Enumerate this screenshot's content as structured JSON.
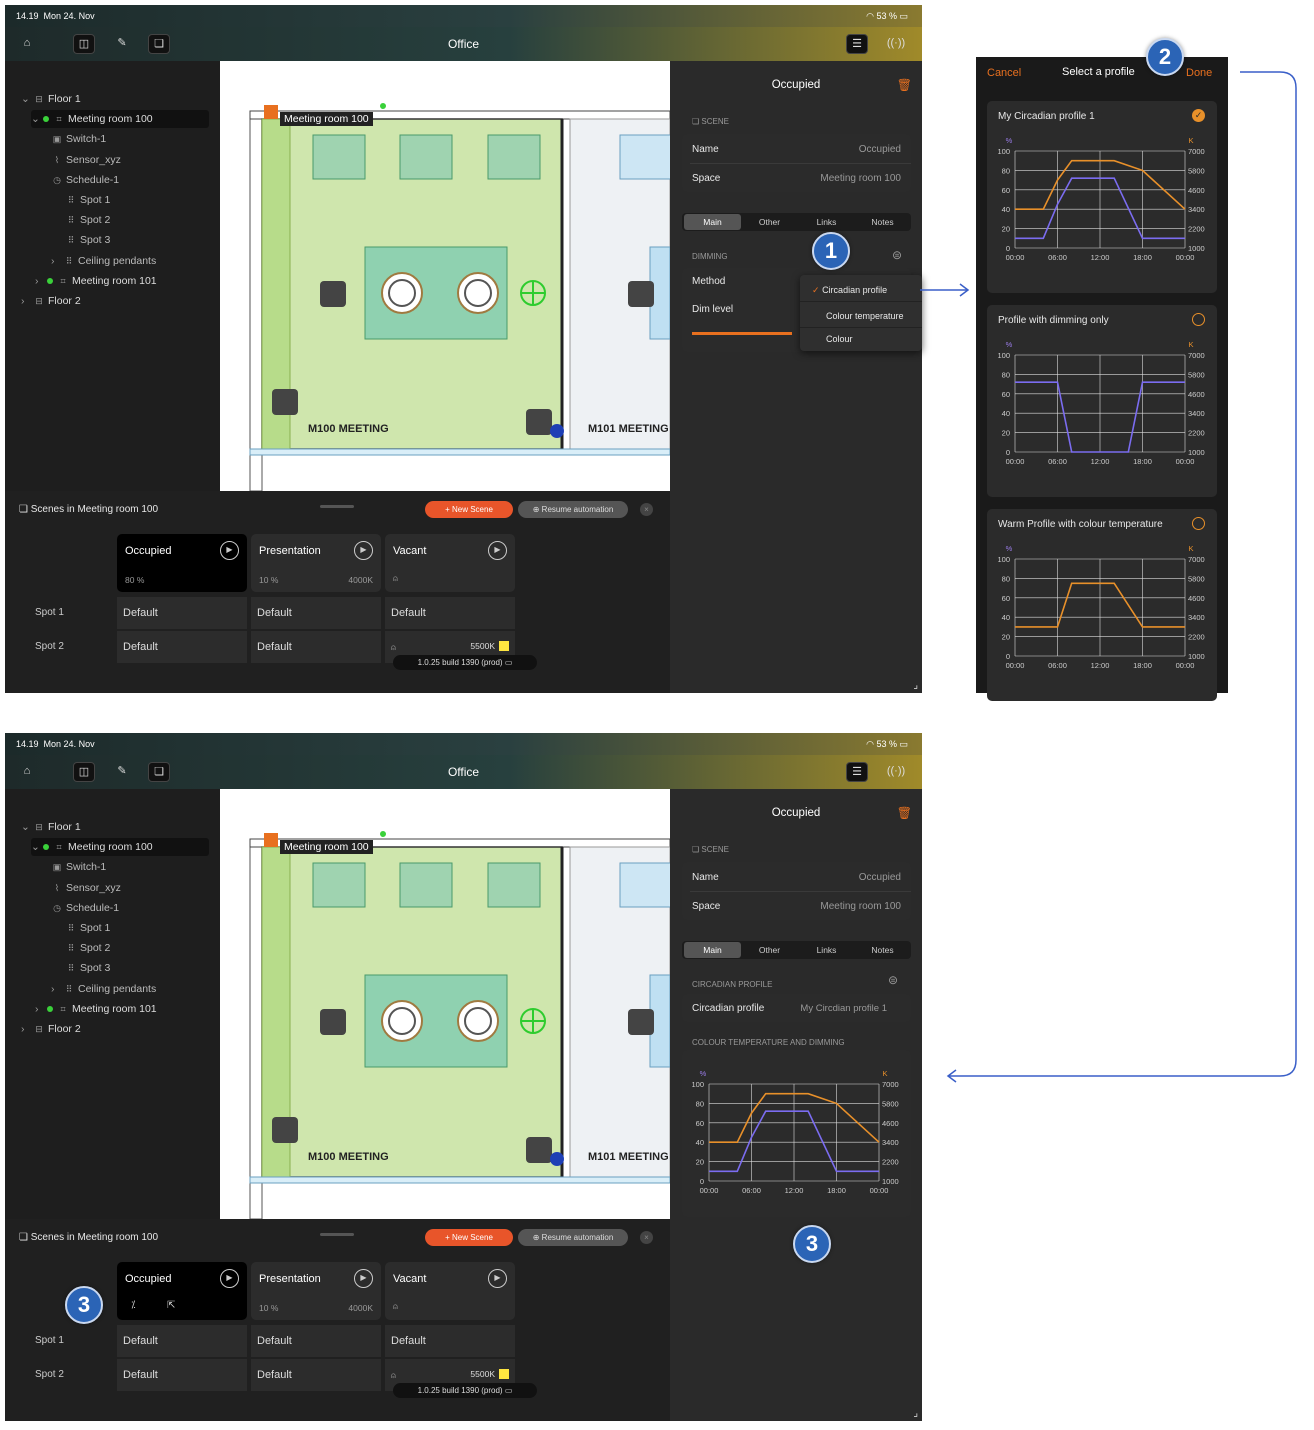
{
  "status_bar": {
    "time": "14.19",
    "date": "Mon 24. Nov",
    "battery": "53 %"
  },
  "toolbar": {
    "title": "Office"
  },
  "tree": [
    {
      "label": "Floor 1",
      "level": 0,
      "chevron": "down",
      "icon": "floor-icon"
    },
    {
      "label": "Meeting room 100",
      "level": 1,
      "chevron": "down",
      "icon": "room-icon",
      "online": true,
      "selected": true
    },
    {
      "label": "Switch-1",
      "level": 2,
      "icon": "switch-icon"
    },
    {
      "label": "Sensor_xyz",
      "level": 2,
      "icon": "sensor-icon"
    },
    {
      "label": "Schedule-1",
      "level": 2,
      "icon": "schedule-icon"
    },
    {
      "label": "Spot 1",
      "level": 3,
      "icon": "light-group-icon"
    },
    {
      "label": "Spot 2",
      "level": 3,
      "icon": "light-group-icon"
    },
    {
      "label": "Spot 3",
      "level": 3,
      "icon": "light-group-icon"
    },
    {
      "label": "Ceiling pendants",
      "level": 2,
      "chevron": "right",
      "icon": "light-group-icon"
    },
    {
      "label": "Meeting room 101",
      "level": 1,
      "chevron": "right",
      "icon": "room-icon",
      "online": true
    },
    {
      "label": "Floor 2",
      "level": 0,
      "chevron": "right",
      "icon": "floor-icon"
    }
  ],
  "floorplan": {
    "room_tag": "Meeting room 100",
    "room1_label": "M100 MEETING",
    "room2_label": "M101 MEETING"
  },
  "scenes_panel": {
    "title": "Scenes in Meeting room 100",
    "new_scene": "New Scene",
    "resume": "Resume automation",
    "scenes_top": [
      {
        "name": "Occupied",
        "left": "80 %",
        "right": "",
        "active": true
      },
      {
        "name": "Presentation",
        "left": "10 %",
        "right": "4000K",
        "active": false
      },
      {
        "name": "Vacant",
        "left": "",
        "right": "",
        "active": false
      }
    ],
    "scenes_bottom": [
      {
        "name": "Occupied",
        "left": "",
        "right": "",
        "active": true
      },
      {
        "name": "Presentation",
        "left": "10 %",
        "right": "4000K",
        "active": false
      },
      {
        "name": "Vacant",
        "left": "",
        "right": "",
        "active": false
      }
    ],
    "rows": [
      {
        "label": "Spot 1",
        "cells": [
          "Default",
          "Default",
          "Default"
        ]
      },
      {
        "label": "Spot 2",
        "cells": [
          "Default",
          "Default",
          "5500K"
        ]
      }
    ],
    "build": "1.0.25 build 1390 (prod)"
  },
  "detail": {
    "title": "Occupied",
    "scene_header": "SCENE",
    "name_label": "Name",
    "name_value": "Occupied",
    "space_label": "Space",
    "space_value": "Meeting room 100",
    "tabs": [
      "Main",
      "Other",
      "Links",
      "Notes"
    ],
    "dimming_header": "DIMMING",
    "method_label": "Method",
    "dim_label": "Dim level",
    "dropdown": [
      "Circadian profile",
      "Colour temperature",
      "Colour"
    ],
    "circ_header": "CIRCADIAN PROFILE",
    "circ_label": "Circadian profile",
    "circ_value": "My Circdian profile 1",
    "ct_header": "COLOUR TEMPERATURE AND DIMMING"
  },
  "profile_picker": {
    "cancel": "Cancel",
    "title": "Select a profile",
    "done": "Done",
    "profiles": [
      {
        "name": "My Circadian profile 1",
        "selected": true
      },
      {
        "name": "Profile with dimming only",
        "selected": false
      },
      {
        "name": "Warm Profile with colour temperature",
        "selected": false
      }
    ]
  },
  "chart_axes": {
    "left_unit": "%",
    "right_unit": "K",
    "left_ticks": [
      "100",
      "80",
      "60",
      "40",
      "20",
      "0"
    ],
    "right_ticks": [
      "7000",
      "5800",
      "4600",
      "3400",
      "2200",
      "1000"
    ],
    "x_ticks": [
      "00:00",
      "06:00",
      "12:00",
      "18:00",
      "00:00"
    ]
  },
  "chart_data": [
    {
      "type": "line",
      "title": "My Circadian profile 1",
      "x": [
        "00:00",
        "04:00",
        "06:00",
        "08:00",
        "12:00",
        "14:00",
        "18:00",
        "24:00"
      ],
      "ylim": [
        0,
        100
      ],
      "y2lim": [
        1000,
        7000
      ],
      "series": [
        {
          "axis": "y2",
          "color": "#e8902a",
          "values_x_hours": [
            0,
            4,
            6,
            8,
            12,
            14,
            18,
            24
          ],
          "values": [
            3400,
            3400,
            5200,
            6400,
            6400,
            6400,
            5800,
            3400
          ]
        },
        {
          "axis": "y",
          "color": "#7b6cf0",
          "values_x_hours": [
            0,
            4,
            6,
            8,
            12,
            14,
            18,
            24
          ],
          "values": [
            10,
            10,
            45,
            72,
            72,
            72,
            10,
            10
          ]
        }
      ]
    },
    {
      "type": "line",
      "title": "Profile with dimming only",
      "ylim": [
        0,
        100
      ],
      "series": [
        {
          "axis": "y",
          "color": "#7b6cf0",
          "values_x_hours": [
            0,
            6,
            8,
            16,
            18,
            24
          ],
          "values": [
            72,
            72,
            0,
            0,
            72,
            72
          ]
        }
      ]
    },
    {
      "type": "line",
      "title": "Warm Profile with colour temperature",
      "y2lim": [
        1000,
        7000
      ],
      "series": [
        {
          "axis": "y2",
          "color": "#e8902a",
          "values_x_hours": [
            0,
            6,
            8,
            12,
            14,
            18,
            24
          ],
          "values": [
            2800,
            2800,
            5500,
            5500,
            5500,
            2800,
            2800
          ]
        }
      ]
    }
  ],
  "annotations": {
    "b1": "1",
    "b2": "2",
    "b3": "3"
  },
  "colors": {
    "accent": "#e8701f",
    "online": "#3ad13a",
    "badge": "#2b64b6",
    "orange_line": "#e8902a",
    "purple_line": "#7b6cf0"
  }
}
